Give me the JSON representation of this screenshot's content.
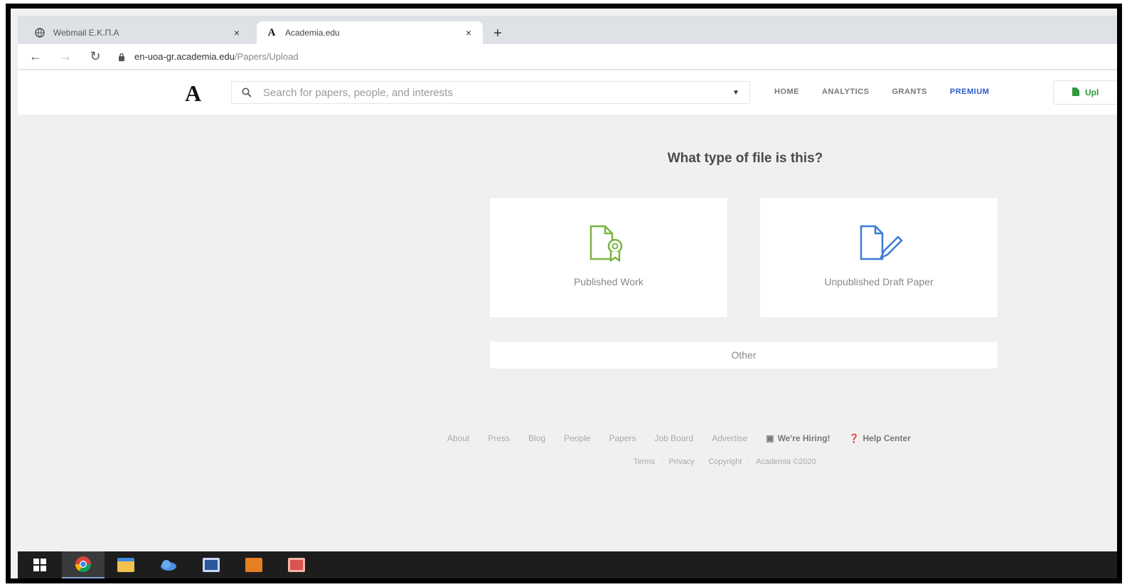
{
  "browser": {
    "tabs": [
      {
        "title": "Webmail Ε.Κ.Π.Α",
        "favicon": "globe-icon",
        "active": false
      },
      {
        "title": "Academia.edu",
        "favicon": "academia-a-icon",
        "active": true
      }
    ],
    "new_tab_symbol": "+",
    "close_symbol": "×",
    "url_host": "en-uoa-gr.academia.edu",
    "url_path": "/Papers/Upload"
  },
  "site": {
    "logo": "A",
    "search_placeholder": "Search for papers, people, and interests",
    "nav": {
      "home": "HOME",
      "analytics": "ANALYTICS",
      "grants": "GRANTS",
      "premium": "PREMIUM"
    },
    "upload_label": "Upl"
  },
  "content": {
    "heading": "What type of file is this?",
    "options": {
      "published": "Published Work",
      "draft": "Unpublished Draft Paper",
      "other": "Other"
    }
  },
  "footer": {
    "links": [
      "About",
      "Press",
      "Blog",
      "People",
      "Papers",
      "Job Board",
      "Advertise"
    ],
    "hiring": "We're Hiring!",
    "help": "Help Center",
    "legal": [
      "Terms",
      "Privacy",
      "Copyright",
      "Academia ©2020"
    ]
  },
  "colors": {
    "accent_blue": "#2a5ac9",
    "published_green": "#7cb342",
    "draft_blue": "#3a7bd5"
  }
}
